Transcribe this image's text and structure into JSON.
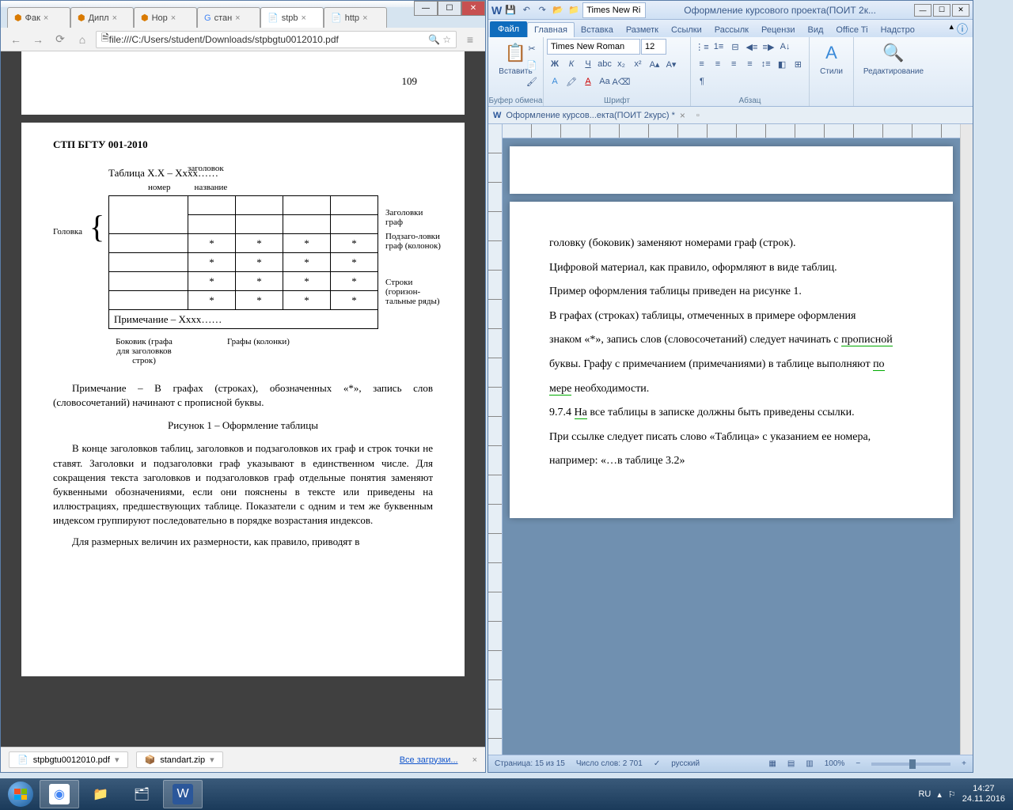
{
  "chrome": {
    "tabs": [
      "Фак",
      "Дипл",
      "Нор",
      "стан",
      "stpb",
      "http"
    ],
    "url": "file:///C:/Users/student/Downloads/stpbgtu0012010.pdf",
    "page_number": "109",
    "stp_header": "СТП БГТУ 001-2010",
    "diagram": {
      "zagolovok": "заголовок",
      "table_caption": "Таблица Х.Х – Хххх……",
      "nomer": "номер",
      "nazvanie": "название",
      "golovka": "Головка",
      "zagolовki_graf": "Заголовки граф",
      "podzagolovki": "Подзаго-ловки граф (колонок)",
      "stroki": "Строки (горизон-тальные ряды)",
      "primechanie": "Примечание – Хххх……",
      "bokovnik": "Боковик (графа для заголовков строк)",
      "grafy": "Графы (колонки)"
    },
    "note": "Примечание – В графах (строках), обозначенных «*», запись слов (словосочетаний) начинают с прописной буквы.",
    "figure_caption": "Рисунок 1 – Оформление таблицы",
    "para1": "В конце заголовков таблиц, заголовков и подзаголовков их граф и строк точки не ставят. Заголовки и подзаголовки граф указывают в единственном числе. Для сокращения текста заголовков и подзаголовков граф отдельные понятия заменяют буквенными обозначениями, если они пояснены в тексте или приведены на иллюстрациях, предшествующих таблице. Показатели с одним и тем же буквенным индексом группируют последовательно в порядке возрастания индексов.",
    "para2": "Для размерных величин их размерности, как правило, приводят в",
    "downloads": {
      "pdf": "stpbgtu0012010.pdf",
      "zip": "standart.zip",
      "all": "Все загрузки..."
    }
  },
  "word": {
    "title": "Оформление курсового проекта(ПОИТ 2к...",
    "qat_font": "Times New Ri",
    "ribbon_tabs": [
      "Файл",
      "Главная",
      "Вставка",
      "Разметк",
      "Ссылки",
      "Рассылк",
      "Рецензи",
      "Вид",
      "Office Ti",
      "Надстро"
    ],
    "font_name": "Times New Roman",
    "font_size": "12",
    "groups": {
      "clipboard": "Буфер обмена",
      "paste": "Вставить",
      "font": "Шрифт",
      "paragraph": "Абзац",
      "styles": "Стили",
      "editing": "Редактирование"
    },
    "doc_tab": "Оформление курсов...екта(ПОИТ 2курс) *",
    "body": {
      "l1": "головку (боковик) заменяют номерами граф (строк).",
      "l2": "Цифровой материал, как правило, оформляют в виде таблиц.",
      "l3": "Пример оформления таблицы приведен на рисунке 1.",
      "l4": "В графах (строках) таблицы, отмеченных в примере оформления",
      "l5_a": "знаком «*», запись слов (словосочетаний) следует начинать с ",
      "l5_b": "прописной",
      "l6_a": "буквы. Графу с примечанием (примечаниями) в таблице выполняют ",
      "l6_b": "по",
      "l7_a": "мере",
      "l7_b": " необходимости.",
      "l8_a": "9.7.4 ",
      "l8_b": "На",
      "l8_c": " все таблицы в записке должны быть приведены ссылки.",
      "l9": "При ссылке следует писать слово «Таблица» с указанием ее номера,",
      "l10": "например: «…в таблице 3.2»"
    },
    "status": {
      "page": "Страница: 15 из 15",
      "words": "Число слов: 2 701",
      "lang": "русский",
      "zoom": "100%"
    }
  },
  "taskbar": {
    "lang": "RU",
    "time": "14:27",
    "date": "24.11.2016"
  }
}
